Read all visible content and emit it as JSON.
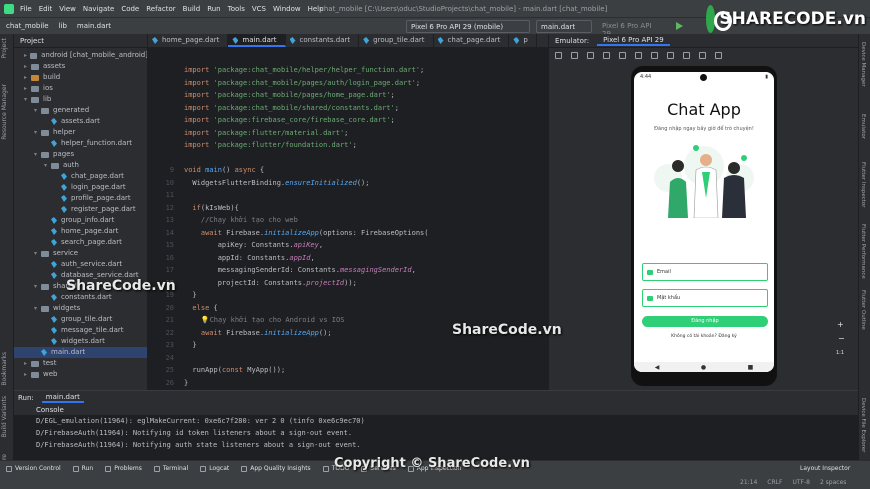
{
  "menubar": {
    "items": [
      "File",
      "Edit",
      "View",
      "Navigate",
      "Code",
      "Refactor",
      "Build",
      "Run",
      "Tools",
      "VCS",
      "Window",
      "Help"
    ],
    "window_title": "chat_mobile [C:\\Users\\oduc\\StudioProjects\\chat_mobile] - main.dart [chat_mobile]"
  },
  "toolbar": {
    "crumbs": [
      "chat_mobile",
      "lib",
      "main.dart"
    ],
    "device": "Pixel 6 Pro API 29 (mobile)",
    "run_config": "main.dart",
    "device2": "Pixel 6 Pro API 29"
  },
  "left_strip": [
    "Project",
    "Resource Manager",
    "Bookmarks",
    "Build Variants",
    "Structure"
  ],
  "right_strip": [
    "Device Manager",
    "Emulator",
    "Flutter Inspector",
    "Flutter Performance",
    "Flutter Outline",
    "Device File Explorer"
  ],
  "project": {
    "header": "Project",
    "tree": [
      {
        "label": "android [chat_mobile_android]",
        "depth": 1,
        "kind": "fold",
        "open": false
      },
      {
        "label": "assets",
        "depth": 1,
        "kind": "fold",
        "open": false
      },
      {
        "label": "build",
        "depth": 1,
        "kind": "fold-o",
        "open": false
      },
      {
        "label": "ios",
        "depth": 1,
        "kind": "fold",
        "open": false
      },
      {
        "label": "lib",
        "depth": 1,
        "kind": "fold",
        "open": true
      },
      {
        "label": "generated",
        "depth": 2,
        "kind": "fold",
        "open": true
      },
      {
        "label": "assets.dart",
        "depth": 3,
        "kind": "dart"
      },
      {
        "label": "helper",
        "depth": 2,
        "kind": "fold",
        "open": true
      },
      {
        "label": "helper_function.dart",
        "depth": 3,
        "kind": "dart"
      },
      {
        "label": "pages",
        "depth": 2,
        "kind": "fold",
        "open": true
      },
      {
        "label": "auth",
        "depth": 3,
        "kind": "fold",
        "open": true
      },
      {
        "label": "chat_page.dart",
        "depth": 4,
        "kind": "dart"
      },
      {
        "label": "login_page.dart",
        "depth": 4,
        "kind": "dart"
      },
      {
        "label": "profile_page.dart",
        "depth": 4,
        "kind": "dart"
      },
      {
        "label": "register_page.dart",
        "depth": 4,
        "kind": "dart"
      },
      {
        "label": "group_info.dart",
        "depth": 3,
        "kind": "dart"
      },
      {
        "label": "home_page.dart",
        "depth": 3,
        "kind": "dart"
      },
      {
        "label": "search_page.dart",
        "depth": 3,
        "kind": "dart"
      },
      {
        "label": "service",
        "depth": 2,
        "kind": "fold",
        "open": true
      },
      {
        "label": "auth_service.dart",
        "depth": 3,
        "kind": "dart"
      },
      {
        "label": "database_service.dart",
        "depth": 3,
        "kind": "dart"
      },
      {
        "label": "shared",
        "depth": 2,
        "kind": "fold",
        "open": true
      },
      {
        "label": "constants.dart",
        "depth": 3,
        "kind": "dart"
      },
      {
        "label": "widgets",
        "depth": 2,
        "kind": "fold",
        "open": true
      },
      {
        "label": "group_tile.dart",
        "depth": 3,
        "kind": "dart"
      },
      {
        "label": "message_tile.dart",
        "depth": 3,
        "kind": "dart"
      },
      {
        "label": "widgets.dart",
        "depth": 3,
        "kind": "dart"
      },
      {
        "label": "main.dart",
        "depth": 2,
        "kind": "dart",
        "selected": true
      },
      {
        "label": "test",
        "depth": 1,
        "kind": "fold",
        "open": false
      },
      {
        "label": "web",
        "depth": 1,
        "kind": "fold",
        "open": false
      }
    ]
  },
  "editor": {
    "tabs": [
      {
        "label": "home_page.dart",
        "active": false
      },
      {
        "label": "main.dart",
        "active": true
      },
      {
        "label": "constants.dart",
        "active": false
      },
      {
        "label": "group_tile.dart",
        "active": false
      },
      {
        "label": "chat_page.dart",
        "active": false
      },
      {
        "label": "p",
        "active": false
      }
    ],
    "lines": [
      {
        "n": "",
        "code": [
          [
            "kw",
            "import "
          ],
          [
            "str",
            "'package:chat_mobile/helper/helper_function.dart'"
          ],
          [
            "cls",
            ";"
          ]
        ]
      },
      {
        "n": "",
        "code": [
          [
            "kw",
            "import "
          ],
          [
            "str",
            "'package:chat_mobile/pages/auth/login_page.dart'"
          ],
          [
            "cls",
            ";"
          ]
        ]
      },
      {
        "n": "",
        "code": [
          [
            "kw",
            "import "
          ],
          [
            "str",
            "'package:chat_mobile/pages/home_page.dart'"
          ],
          [
            "cls",
            ";"
          ]
        ]
      },
      {
        "n": "",
        "code": [
          [
            "kw",
            "import "
          ],
          [
            "str",
            "'package:chat_mobile/shared/constants.dart'"
          ],
          [
            "cls",
            ";"
          ]
        ]
      },
      {
        "n": "",
        "code": [
          [
            "kw",
            "import "
          ],
          [
            "str",
            "'package:firebase_core/firebase_core.dart'"
          ],
          [
            "cls",
            ";"
          ]
        ]
      },
      {
        "n": "",
        "code": [
          [
            "kw",
            "import "
          ],
          [
            "str",
            "'package:flutter/material.dart'"
          ],
          [
            "cls",
            ";"
          ]
        ]
      },
      {
        "n": "",
        "code": [
          [
            "kw",
            "import "
          ],
          [
            "str",
            "'package:flutter/foundation.dart'"
          ],
          [
            "cls",
            ";"
          ]
        ]
      },
      {
        "n": "",
        "code": []
      },
      {
        "n": "9",
        "code": [
          [
            "kw",
            "void "
          ],
          [
            "fn",
            "main"
          ],
          [
            "cls",
            "() "
          ],
          [
            "kw",
            "async "
          ],
          [
            "cls",
            "{"
          ]
        ]
      },
      {
        "n": "10",
        "code": [
          [
            "cls",
            "  WidgetsFlutterBinding."
          ],
          [
            "fni",
            "ensureInitialized"
          ],
          [
            "cls",
            "();"
          ]
        ]
      },
      {
        "n": "11",
        "code": []
      },
      {
        "n": "12",
        "code": [
          [
            "kw",
            "  if"
          ],
          [
            "cls",
            "(kIsWeb){"
          ]
        ]
      },
      {
        "n": "13",
        "code": [
          [
            "cm",
            "    //Chạy khởi tạo cho web"
          ]
        ]
      },
      {
        "n": "14",
        "code": [
          [
            "kw",
            "    await "
          ],
          [
            "cls",
            "Firebase."
          ],
          [
            "fni",
            "initializeApp"
          ],
          [
            "cls",
            "(options: FirebaseOptions("
          ]
        ]
      },
      {
        "n": "15",
        "code": [
          [
            "cls",
            "        apiKey: Constants."
          ],
          [
            "it",
            "apiKey"
          ],
          [
            "cls",
            ","
          ]
        ]
      },
      {
        "n": "16",
        "code": [
          [
            "cls",
            "        appId: Constants."
          ],
          [
            "it",
            "appId"
          ],
          [
            "cls",
            ","
          ]
        ]
      },
      {
        "n": "17",
        "code": [
          [
            "cls",
            "        messagingSenderId: Constants."
          ],
          [
            "it",
            "messagingSenderId"
          ],
          [
            "cls",
            ","
          ]
        ]
      },
      {
        "n": "18",
        "code": [
          [
            "cls",
            "        projectId: Constants."
          ],
          [
            "it",
            "projectId"
          ],
          [
            "cls",
            "));"
          ]
        ]
      },
      {
        "n": "19",
        "code": [
          [
            "cls",
            "  }"
          ]
        ]
      },
      {
        "n": "20",
        "code": [
          [
            "kw",
            "  else "
          ],
          [
            "cls",
            "{"
          ]
        ]
      },
      {
        "n": "21",
        "code": [
          [
            "cm",
            "    💡Chạy khởi tạo cho Android vs IOS"
          ]
        ]
      },
      {
        "n": "22",
        "code": [
          [
            "kw",
            "    await "
          ],
          [
            "cls",
            "Firebase."
          ],
          [
            "fni",
            "initializeApp"
          ],
          [
            "cls",
            "();"
          ]
        ]
      },
      {
        "n": "23",
        "code": [
          [
            "cls",
            "  }"
          ]
        ]
      },
      {
        "n": "24",
        "code": []
      },
      {
        "n": "25",
        "code": [
          [
            "cls",
            "  runApp("
          ],
          [
            "kw",
            "const "
          ],
          [
            "cls",
            "MyApp());"
          ]
        ]
      },
      {
        "n": "26",
        "code": [
          [
            "cls",
            "}"
          ]
        ]
      },
      {
        "n": "27",
        "code": []
      }
    ]
  },
  "emulator": {
    "header": "Emulator:",
    "tab": "Pixel 6 Pro API 29",
    "app": {
      "status_time": "4:44",
      "title": "Chat App",
      "subtitle": "Đăng nhập ngay bây giờ để trò chuyện!",
      "email_placeholder": "Email",
      "password_placeholder": "Mật khẩu",
      "login_button": "Đăng nhập",
      "register_prompt": "Không có tài khoản? Đăng ký"
    },
    "zoom": "1:1"
  },
  "run": {
    "label": "Run:",
    "config": "main.dart",
    "console_tab": "Console",
    "logs": [
      "D/EGL_emulation(11964): eglMakeCurrent: 0xe6c7f280: ver 2 0 (tinfo 0xe6c9ec70)",
      "D/FirebaseAuth(11964): Notifying id token listeners about a sign-out event.",
      "D/FirebaseAuth(11964): Notifying auth state listeners about a sign-out event."
    ]
  },
  "statusbar": {
    "tools": [
      "Version Control",
      "Run",
      "Problems",
      "Terminal",
      "Logcat",
      "App Quality Insights",
      "TODO",
      "Services",
      "App Inspection"
    ],
    "right": [
      "21:14",
      "CRLF",
      "UTF-8",
      "2 spaces"
    ],
    "layout_inspector": "Layout Inspector"
  },
  "watermarks": {
    "brand": "SHARECODE.vn",
    "wm1": "ShareCode.vn",
    "wm2": "ShareCode.vn",
    "wm3": "Copyright © ShareCode.vn"
  }
}
